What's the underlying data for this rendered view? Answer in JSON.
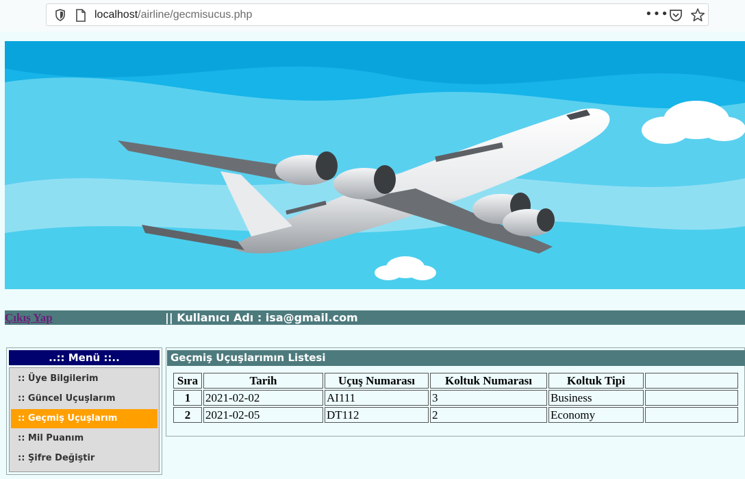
{
  "browser": {
    "url_host": "localhost",
    "url_path": "/airline/gecmisucus.php",
    "more_label": "•••"
  },
  "userbar": {
    "logout_label": "Çıkış Yap",
    "username_text": "|| Kullanıcı Adı : isa@gmail.com"
  },
  "menu": {
    "title": "..:: Menü ::..",
    "items": [
      {
        "label": ":: Üye Bilgilerim"
      },
      {
        "label": ":: Güncel Uçuşlarım"
      },
      {
        "label": ":: Geçmiş Uçuşlarım"
      },
      {
        "label": ":: Mil Puanım"
      },
      {
        "label": ":: Şifre Değiştir"
      }
    ],
    "active_index": 2
  },
  "panel": {
    "title": "Geçmiş Uçuşlarımın Listesi",
    "columns": [
      "Sıra",
      "Tarih",
      "Uçuş Numarası",
      "Koltuk Numarası",
      "Koltuk Tipi",
      ""
    ],
    "rows": [
      [
        "1",
        "2021-02-02",
        "AI111",
        "3",
        "Business",
        ""
      ],
      [
        "2",
        "2021-02-05",
        "DT112",
        "2",
        "Economy",
        ""
      ]
    ]
  },
  "colors": {
    "accent_active": "#ff9f00",
    "menu_title_bg": "#00006e",
    "bar_bg": "#4d7a7d",
    "link_color": "#6b1e7b",
    "sky": "#16b4e8"
  }
}
